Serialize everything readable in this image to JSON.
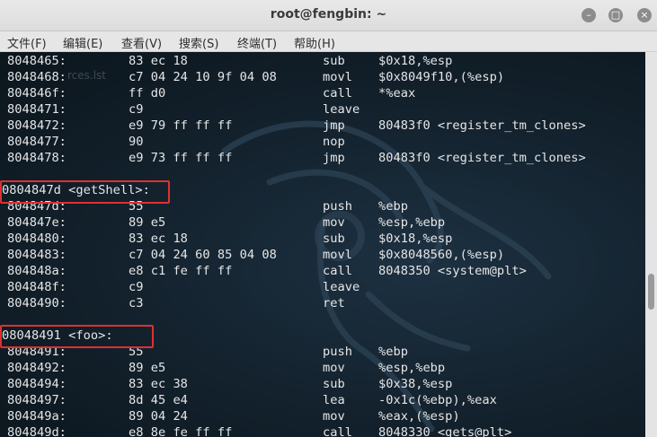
{
  "window": {
    "title": "root@fengbin: ~",
    "buttons": {
      "minimize": "–",
      "maximize": "□",
      "close": "×"
    }
  },
  "menu": [
    {
      "label": "文件(F)"
    },
    {
      "label": "编辑(E)"
    },
    {
      "label": "查看(V)"
    },
    {
      "label": "搜索(S)"
    },
    {
      "label": "终端(T)"
    },
    {
      "label": "帮助(H)"
    }
  ],
  "ghost_text": "rces.lst",
  "lines": [
    {
      "addr": "8048465:",
      "bytes": "83 ec 18",
      "mnemonic": "sub",
      "operands": "$0x18,%esp"
    },
    {
      "addr": "8048468:",
      "bytes": "c7 04 24 10 9f 04 08",
      "mnemonic": "movl",
      "operands": "$0x8049f10,(%esp)"
    },
    {
      "addr": "804846f:",
      "bytes": "ff d0",
      "mnemonic": "call",
      "operands": "*%eax"
    },
    {
      "addr": "8048471:",
      "bytes": "c9",
      "mnemonic": "leave",
      "operands": ""
    },
    {
      "addr": "8048472:",
      "bytes": "e9 79 ff ff ff",
      "mnemonic": "jmp",
      "operands": "80483f0 <register_tm_clones>"
    },
    {
      "addr": "8048477:",
      "bytes": "90",
      "mnemonic": "nop",
      "operands": ""
    },
    {
      "addr": "8048478:",
      "bytes": "e9 73 ff ff ff",
      "mnemonic": "jmp",
      "operands": "80483f0 <register_tm_clones>"
    },
    {
      "label": ""
    },
    {
      "label": "0804847d <getShell>:"
    },
    {
      "addr": "804847d:",
      "bytes": "55",
      "mnemonic": "push",
      "operands": "%ebp"
    },
    {
      "addr": "804847e:",
      "bytes": "89 e5",
      "mnemonic": "mov",
      "operands": "%esp,%ebp"
    },
    {
      "addr": "8048480:",
      "bytes": "83 ec 18",
      "mnemonic": "sub",
      "operands": "$0x18,%esp"
    },
    {
      "addr": "8048483:",
      "bytes": "c7 04 24 60 85 04 08",
      "mnemonic": "movl",
      "operands": "$0x8048560,(%esp)"
    },
    {
      "addr": "804848a:",
      "bytes": "e8 c1 fe ff ff",
      "mnemonic": "call",
      "operands": "8048350 <system@plt>"
    },
    {
      "addr": "804848f:",
      "bytes": "c9",
      "mnemonic": "leave",
      "operands": ""
    },
    {
      "addr": "8048490:",
      "bytes": "c3",
      "mnemonic": "ret",
      "operands": ""
    },
    {
      "label": ""
    },
    {
      "label": "08048491 <foo>:"
    },
    {
      "addr": "8048491:",
      "bytes": "55",
      "mnemonic": "push",
      "operands": "%ebp"
    },
    {
      "addr": "8048492:",
      "bytes": "89 e5",
      "mnemonic": "mov",
      "operands": "%esp,%ebp"
    },
    {
      "addr": "8048494:",
      "bytes": "83 ec 38",
      "mnemonic": "sub",
      "operands": "$0x38,%esp"
    },
    {
      "addr": "8048497:",
      "bytes": "8d 45 e4",
      "mnemonic": "lea",
      "operands": "-0x1c(%ebp),%eax"
    },
    {
      "addr": "804849a:",
      "bytes": "89 04 24",
      "mnemonic": "mov",
      "operands": "%eax,(%esp)"
    },
    {
      "addr": "804849d:",
      "bytes": "e8 8e fe ff ff",
      "mnemonic": "call",
      "operands": "8048330 <gets@plt>"
    }
  ],
  "colors": {
    "highlight": "#e03030",
    "terminal_text": "#e6e6e6"
  }
}
